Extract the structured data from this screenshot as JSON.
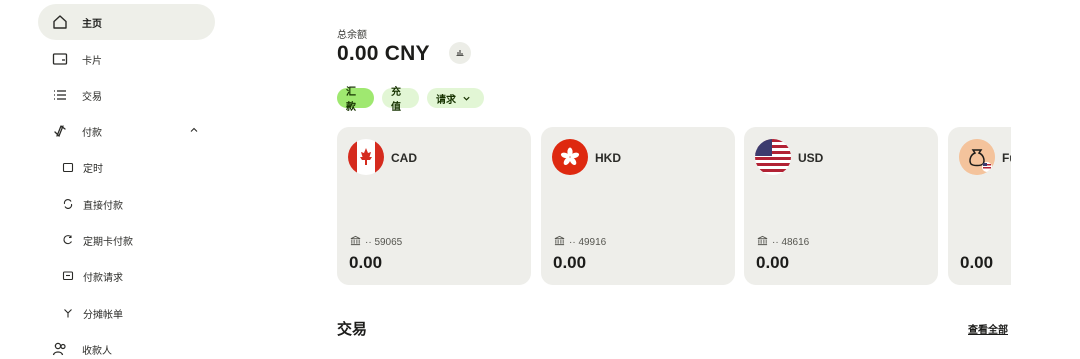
{
  "sidebar": {
    "items": [
      {
        "label": "主页",
        "icon": "home-icon"
      },
      {
        "label": "卡片",
        "icon": "card-icon"
      },
      {
        "label": "交易",
        "icon": "list-icon"
      },
      {
        "label": "付款",
        "icon": "transfer-arrows-icon"
      },
      {
        "label": "定时",
        "icon": "calendar-icon"
      },
      {
        "label": "直接付款",
        "icon": "refresh-icon"
      },
      {
        "label": "定期卡付款",
        "icon": "recurring-icon"
      },
      {
        "label": "付款请求",
        "icon": "request-icon"
      },
      {
        "label": "分摊帐单",
        "icon": "split-icon"
      },
      {
        "label": "收款人",
        "icon": "recipients-icon"
      }
    ]
  },
  "balance": {
    "label": "总余额",
    "amount": "0.00 CNY"
  },
  "actions": {
    "send": "汇款",
    "topup": "充值",
    "request": "请求"
  },
  "cards": [
    {
      "code": "CAD",
      "flag": "canada-flag-icon",
      "account": "·· 59065",
      "amount": "0.00"
    },
    {
      "code": "HKD",
      "flag": "hong-kong-flag-icon",
      "account": "·· 49916",
      "amount": "0.00"
    },
    {
      "code": "USD",
      "flag": "us-flag-icon",
      "account": "·· 48616",
      "amount": "0.00"
    },
    {
      "code": "Fu",
      "flag": "money-bag-icon",
      "amount": "0.00"
    }
  ],
  "transactions": {
    "title": "交易",
    "view_all": "查看全部"
  },
  "colors": {
    "primary_green": "#9fe870",
    "secondary_green": "#e2f6d5",
    "card_bg": "#eeeeea",
    "active_nav_bg": "#eeefe9"
  }
}
